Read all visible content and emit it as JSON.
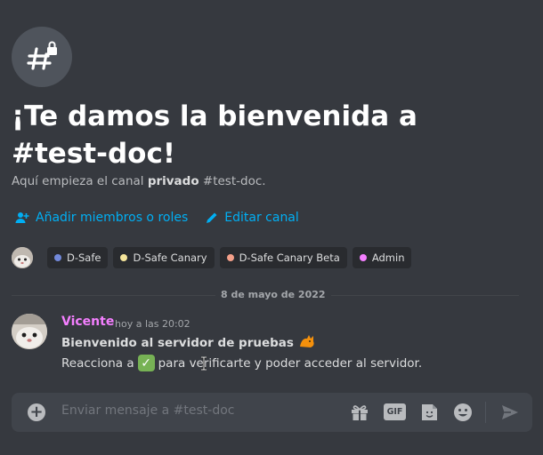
{
  "welcome": {
    "title": "¡Te damos la bienvenida a #test-doc!",
    "subtitle_prefix": "Aquí empieza el canal ",
    "subtitle_bold": "privado",
    "subtitle_suffix": " #test-doc."
  },
  "actions": {
    "add_members": "Añadir miembros o roles",
    "edit_channel": "Editar canal"
  },
  "roles": [
    {
      "name": "D-Safe",
      "color": "#7289da"
    },
    {
      "name": "D-Safe Canary",
      "color": "#f5e59b"
    },
    {
      "name": "D-Safe Canary Beta",
      "color": "#f4a08a"
    },
    {
      "name": "Admin",
      "color": "#f47fff"
    }
  ],
  "date_divider": "8 de mayo de 2022",
  "message": {
    "author": "Vicente",
    "author_color": "#f47fff",
    "timestamp": "hoy a las 20:02",
    "line1": "Bienvenido al servidor de pruebas",
    "line2_prefix": "Reacciona a",
    "line2_suffix": "para verificarte y poder acceder al servidor."
  },
  "composer": {
    "placeholder": "Enviar mensaje a #test-doc",
    "gif_label": "GIF"
  }
}
